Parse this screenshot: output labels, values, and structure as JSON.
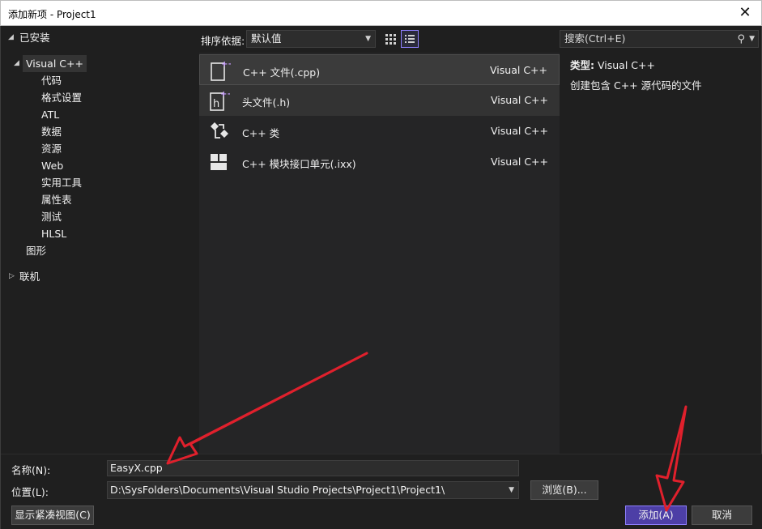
{
  "window": {
    "title": "添加新项 - Project1",
    "close_glyph": "✕"
  },
  "tree": {
    "installed": "已安装",
    "visual_cpp": "Visual C++",
    "children": [
      "代码",
      "格式设置",
      "ATL",
      "数据",
      "资源",
      "Web",
      "实用工具",
      "属性表",
      "测试",
      "HLSL"
    ],
    "graphics": "图形",
    "online": "联机"
  },
  "sort": {
    "label": "排序依据:",
    "value": "默认值"
  },
  "items": [
    {
      "name": "C++ 文件(.cpp)",
      "lang": "Visual C++",
      "icon": "cpp-file-icon"
    },
    {
      "name": "头文件(.h)",
      "lang": "Visual C++",
      "icon": "header-file-icon"
    },
    {
      "name": "C++ 类",
      "lang": "Visual C++",
      "icon": "class-icon"
    },
    {
      "name": "C++ 模块接口单元(.ixx)",
      "lang": "Visual C++",
      "icon": "module-icon"
    }
  ],
  "search": {
    "placeholder": "搜索(Ctrl+E)"
  },
  "info": {
    "type_label": "类型:",
    "type_value": "Visual C++",
    "description": "创建包含 C++ 源代码的文件"
  },
  "form": {
    "name_label": "名称(N):",
    "name_value": "EasyX.cpp",
    "location_label": "位置(L):",
    "location_value": "D:\\SysFolders\\Documents\\Visual Studio Projects\\Project1\\Project1\\"
  },
  "buttons": {
    "browse": "浏览(B)...",
    "compact": "显示紧凑视图(C)",
    "add": "添加(A)",
    "cancel": "取消"
  },
  "colors": {
    "accent": "#8f80ff",
    "annotation": "#e0202c",
    "background": "#1f1f1f",
    "panel": "#252526"
  }
}
